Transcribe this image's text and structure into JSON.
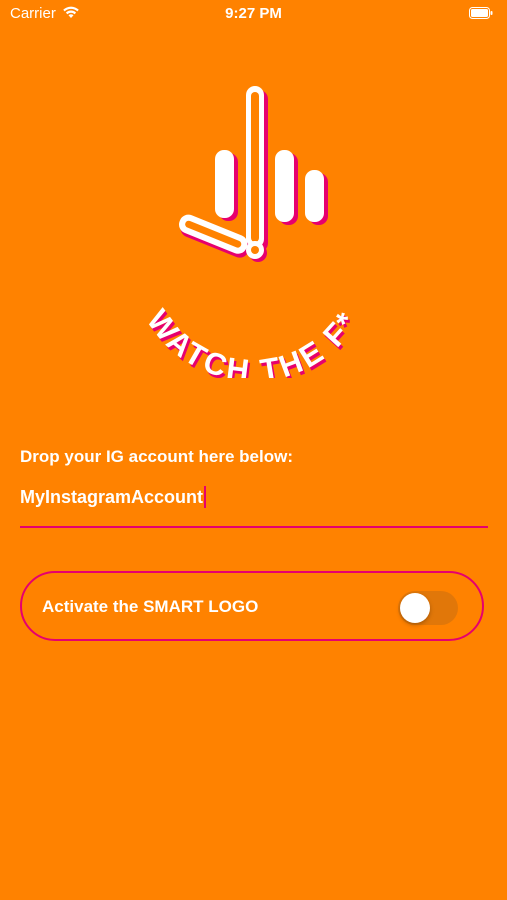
{
  "status_bar": {
    "carrier": "Carrier",
    "time": "9:27 PM",
    "wifi_icon": "wifi-icon",
    "battery_icon": "battery-icon"
  },
  "logo": {
    "text": "WATCH THE F*",
    "icon": "middle-finger-watch-icon"
  },
  "account": {
    "prompt": "Drop your IG account here below:",
    "value": "MyInstagramAccount"
  },
  "smart_logo": {
    "label": "Activate the SMART LOGO",
    "enabled": false
  },
  "colors": {
    "background": "#FF8200",
    "accent": "#E6006E",
    "text": "#FFFFFF"
  }
}
